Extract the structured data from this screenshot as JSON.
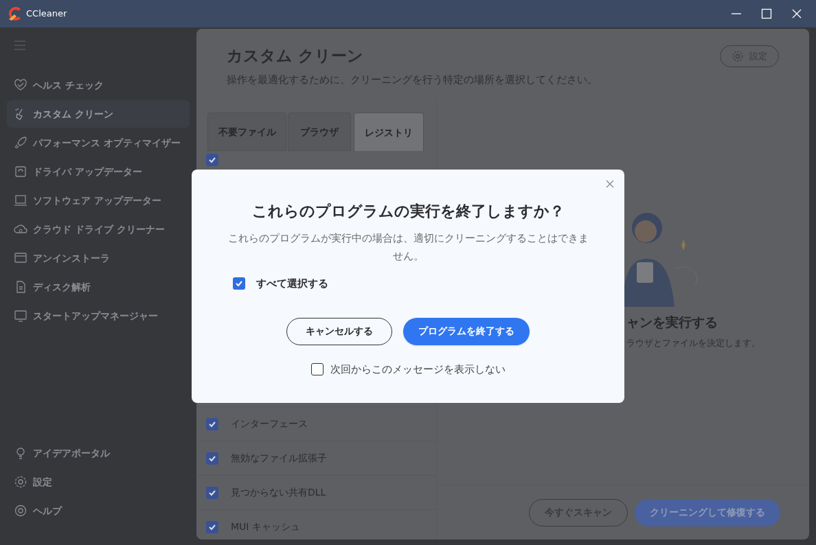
{
  "window": {
    "title": "CCleaner"
  },
  "sidebar": {
    "items": [
      {
        "label": "ヘルス チェック",
        "selected": false
      },
      {
        "label": "カスタム クリーン",
        "selected": true
      },
      {
        "label": "パフォーマンス オプティマイザー",
        "selected": false
      },
      {
        "label": "ドライバ アップデーター",
        "selected": false
      },
      {
        "label": "ソフトウェア アップデーター",
        "selected": false
      },
      {
        "label": "クラウド ドライブ クリーナー",
        "selected": false
      },
      {
        "label": "アンインストーラ",
        "selected": false
      },
      {
        "label": "ディスク解析",
        "selected": false
      },
      {
        "label": "スタートアップマネージャー",
        "selected": false
      }
    ],
    "bottom_items": [
      {
        "label": "アイデアポータル"
      },
      {
        "label": "設定"
      },
      {
        "label": "ヘルプ"
      }
    ]
  },
  "main": {
    "title": "カスタム クリーン",
    "subtitle": "操作を最適化するために、クリーニングを行う特定の場所を選択してください。",
    "settings_button": "設定",
    "tabs": [
      {
        "label": "不要ファイル",
        "selected": false
      },
      {
        "label": "ブラウザ",
        "selected": false
      },
      {
        "label": "レジストリ",
        "selected": true
      }
    ],
    "first_row": {
      "checked": true
    },
    "rows": [
      {
        "label": "インターフェース",
        "checked": true
      },
      {
        "label": "無効なファイル拡張子",
        "checked": true
      },
      {
        "label": "見つからない共有DLL",
        "checked": true
      },
      {
        "label": "MUI キャッシュ",
        "checked": true
      }
    ],
    "empty_state": {
      "heading": "ャンを実行する",
      "text": "ラウザとファイルを決定します。"
    },
    "scan_button": "今すぐスキャン",
    "clean_button": "クリーニングして修復する"
  },
  "dialog": {
    "title": "これらのプログラムの実行を終了しますか？",
    "message": "これらのプログラムが実行中の場合は、適切にクリーニングすることはできません。",
    "select_all": {
      "label": "すべて選択する",
      "checked": true
    },
    "cancel_button": "キャンセルする",
    "confirm_button": "プログラムを終了する",
    "dont_show": {
      "label": "次回からこのメッセージを表示しない",
      "checked": false
    }
  }
}
